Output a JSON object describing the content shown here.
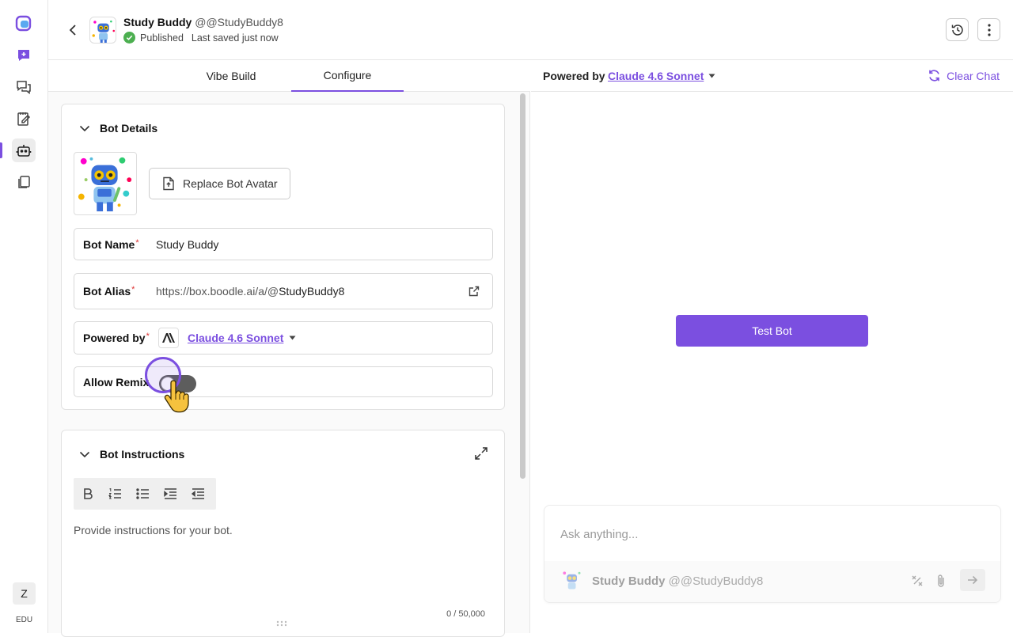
{
  "header": {
    "bot_name": "Study Buddy",
    "bot_handle": "@@StudyBuddy8",
    "status": "Published",
    "saved_text": "Last saved just now"
  },
  "tabs": [
    {
      "label": "Vibe Build",
      "active": false
    },
    {
      "label": "Configure",
      "active": true
    }
  ],
  "bot_details": {
    "section_title": "Bot Details",
    "replace_avatar_label": "Replace Bot Avatar",
    "name_label": "Bot Name",
    "name_value": "Study Buddy",
    "alias_label": "Bot Alias",
    "alias_prefix": "https://box.boodle.ai/a/@",
    "alias_value": "StudyBuddy8",
    "powered_by_label": "Powered by",
    "model": "Claude 4.6 Sonnet",
    "allow_remix_label": "Allow Remix",
    "allow_remix_on": false
  },
  "instructions": {
    "section_title": "Bot Instructions",
    "placeholder": "Provide instructions for your bot.",
    "counter": "0 / 50,000",
    "toolbar": [
      "bold-icon",
      "numbered-list-icon",
      "bullet-list-icon",
      "indent-icon",
      "outdent-icon"
    ]
  },
  "chat": {
    "powered_by_label": "Powered by",
    "model": "Claude 4.6 Sonnet",
    "clear_label": "Clear Chat",
    "test_button": "Test Bot",
    "input_placeholder": "Ask anything...",
    "footer_name": "Study Buddy",
    "footer_handle": "@@StudyBuddy8"
  },
  "rail": {
    "user_initial": "Z",
    "plan_label": "EDU",
    "items": [
      "logo-icon",
      "new-chat-icon",
      "chats-icon",
      "notes-icon",
      "bots-icon",
      "files-icon"
    ],
    "active_item": "bots-icon"
  },
  "colors": {
    "accent": "#7b4fe0",
    "published": "#4caf50",
    "required": "#dd3333",
    "toggle_off": "#5d5d5d"
  }
}
